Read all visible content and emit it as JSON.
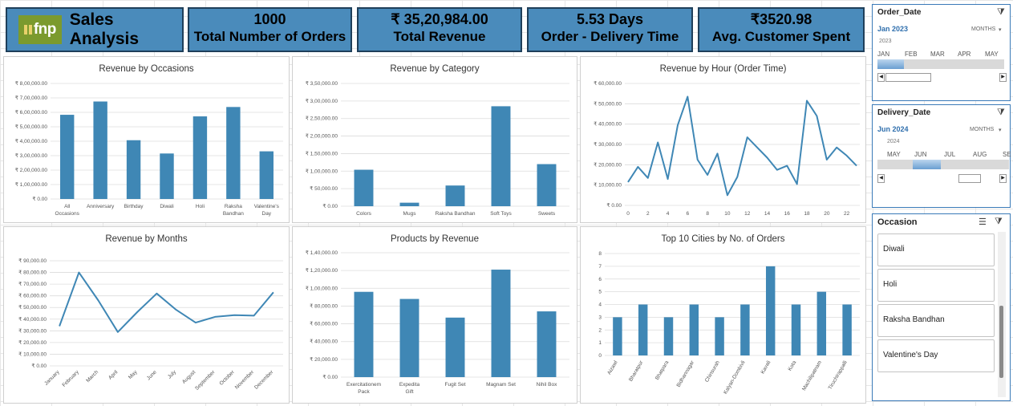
{
  "brand": {
    "logo_text": "fnp",
    "title": "Sales Analysis"
  },
  "kpis": [
    {
      "value": "1000",
      "label": "Total Number of Orders"
    },
    {
      "value": "₹ 35,20,984.00",
      "label": "Total Revenue"
    },
    {
      "value": "5.53 Days",
      "label": "Order - Delivery Time"
    },
    {
      "value": "₹3520.98",
      "label": "Avg. Customer Spent"
    }
  ],
  "order_date_slicer": {
    "title": "Order_Date",
    "selected": "Jan 2023",
    "period": "MONTHS",
    "year": "2023",
    "months": [
      "JAN",
      "FEB",
      "MAR",
      "APR",
      "MAY"
    ]
  },
  "delivery_date_slicer": {
    "title": "Delivery_Date",
    "selected": "Jun 2024",
    "period": "MONTHS",
    "year": "2024",
    "months": [
      "MAY",
      "JUN",
      "JUL",
      "AUG",
      "SE"
    ]
  },
  "occasion_slicer": {
    "title": "Occasion",
    "items": [
      "Diwali",
      "Holi",
      "Raksha Bandhan",
      "Valentine's Day"
    ]
  },
  "chart_data": [
    {
      "type": "bar",
      "title": "Revenue by Occasions",
      "categories": [
        "All Occasions",
        "Anniversary",
        "Birthday",
        "Diwali",
        "Holi",
        "Raksha Bandhan",
        "Valentine's Day"
      ],
      "values": [
        583000,
        675000,
        407000,
        315000,
        572000,
        637000,
        330000
      ],
      "ylim": [
        0,
        800000
      ],
      "ystep": 100000,
      "yticks": [
        "₹ 0.00",
        "₹ 1,00,000.00",
        "₹ 2,00,000.00",
        "₹ 3,00,000.00",
        "₹ 4,00,000.00",
        "₹ 5,00,000.00",
        "₹ 6,00,000.00",
        "₹ 7,00,000.00",
        "₹ 8,00,000.00"
      ],
      "color": "#3f87b5"
    },
    {
      "type": "bar",
      "title": "Revenue by Category",
      "categories": [
        "Colors",
        "Mugs",
        "Raksha Bandhan",
        "Soft Toys",
        "Sweets"
      ],
      "values": [
        104000,
        10000,
        59000,
        285000,
        120000
      ],
      "ylim": [
        0,
        350000
      ],
      "ystep": 50000,
      "yticks": [
        "₹ 0.00",
        "₹ 50,000.00",
        "₹ 1,00,000.00",
        "₹ 1,50,000.00",
        "₹ 2,00,000.00",
        "₹ 2,50,000.00",
        "₹ 3,00,000.00",
        "₹ 3,50,000.00"
      ],
      "color": "#3f87b5"
    },
    {
      "type": "line",
      "title": "Revenue by Hour (Order Time)",
      "x": [
        0,
        1,
        2,
        3,
        4,
        5,
        6,
        7,
        8,
        9,
        10,
        11,
        12,
        13,
        14,
        15,
        16,
        17,
        18,
        19,
        20,
        21,
        22,
        23
      ],
      "values": [
        11500,
        19000,
        13500,
        31000,
        13000,
        39500,
        53500,
        22500,
        15000,
        25500,
        5000,
        14000,
        33500,
        28500,
        23500,
        17500,
        19500,
        10500,
        51500,
        44000,
        22500,
        28500,
        24500,
        19500
      ],
      "xticks": [
        "0",
        "2",
        "4",
        "6",
        "8",
        "10",
        "12",
        "14",
        "16",
        "18",
        "20",
        "22"
      ],
      "ylim": [
        0,
        60000
      ],
      "ystep": 10000,
      "yticks": [
        "₹ 0.00",
        "₹ 10,000.00",
        "₹ 20,000.00",
        "₹ 30,000.00",
        "₹ 40,000.00",
        "₹ 50,000.00",
        "₹ 60,000.00"
      ],
      "color": "#3f87b5"
    },
    {
      "type": "line",
      "title": "Revenue by Months",
      "categories": [
        "January",
        "February",
        "March",
        "April",
        "May",
        "June",
        "July",
        "August",
        "September",
        "October",
        "November",
        "December"
      ],
      "values": [
        34000,
        80000,
        56000,
        29000,
        46000,
        62000,
        48000,
        37000,
        42000,
        43500,
        43000,
        63000
      ],
      "ylim": [
        0,
        90000
      ],
      "ystep": 10000,
      "yticks": [
        "₹ 0.00",
        "₹ 10,000.00",
        "₹ 20,000.00",
        "₹ 30,000.00",
        "₹ 40,000.00",
        "₹ 50,000.00",
        "₹ 60,000.00",
        "₹ 70,000.00",
        "₹ 80,000.00",
        "₹ 90,000.00"
      ],
      "color": "#3f87b5"
    },
    {
      "type": "bar",
      "title": "Products by Revenue",
      "categories": [
        "Exercitationem Pack",
        "Expedita Gift",
        "Fugit Set",
        "Magnam Set",
        "Nihil Box"
      ],
      "values": [
        96000,
        88000,
        67000,
        121000,
        74000
      ],
      "ylim": [
        0,
        140000
      ],
      "ystep": 20000,
      "yticks": [
        "₹ 0.00",
        "₹ 20,000.00",
        "₹ 40,000.00",
        "₹ 60,000.00",
        "₹ 80,000.00",
        "₹ 1,00,000.00",
        "₹ 1,20,000.00",
        "₹ 1,40,000.00"
      ],
      "color": "#3f87b5"
    },
    {
      "type": "bar",
      "title": "Top 10 Cities by No. of Orders",
      "categories": [
        "Aizawl",
        "Bharatpur",
        "Bhatpara",
        "Bidhannagar",
        "Chinsurah",
        "Kalyan-Dombivli",
        "Kavali",
        "Kota",
        "Machilipatnam",
        "Tiruchirappalli"
      ],
      "values": [
        3,
        4,
        3,
        4,
        3,
        4,
        7,
        4,
        5,
        4
      ],
      "ylim": [
        0,
        8
      ],
      "ystep": 1,
      "yticks": [
        "0",
        "1",
        "2",
        "3",
        "4",
        "5",
        "6",
        "7",
        "8"
      ],
      "color": "#3f87b5"
    }
  ]
}
